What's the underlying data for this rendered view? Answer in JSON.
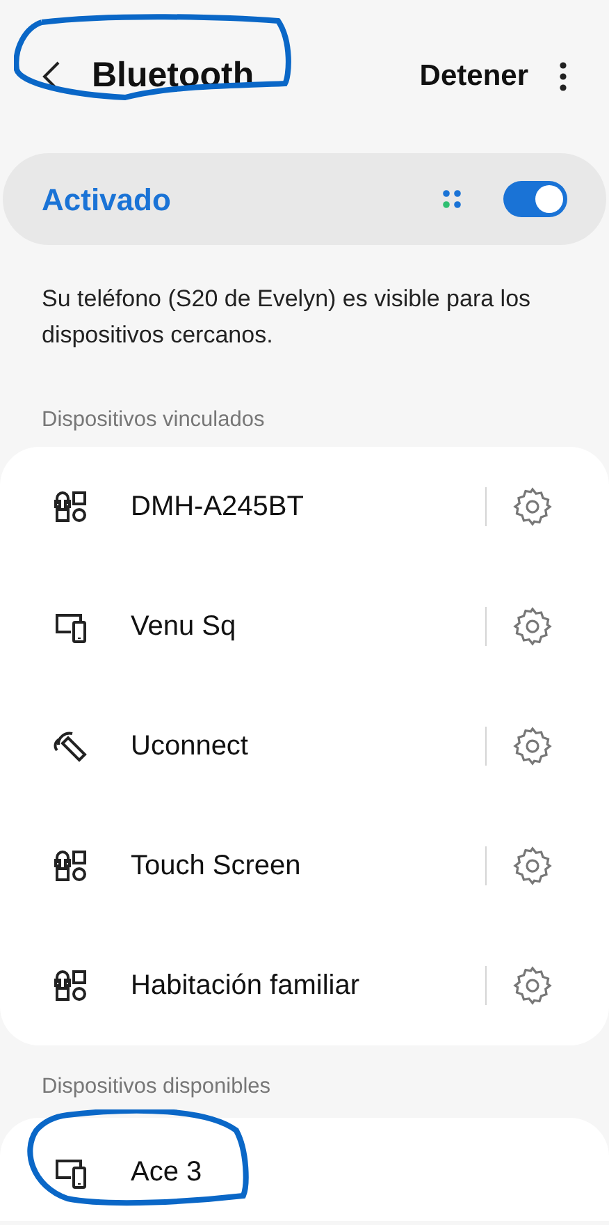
{
  "header": {
    "title": "Bluetooth",
    "circled": true,
    "action": "Detener"
  },
  "master": {
    "label": "Activado",
    "on": true
  },
  "description": "Su teléfono (S20 de Evelyn) es visible para los dispositivos cercanos.",
  "paired": {
    "heading": "Dispositivos vinculados",
    "devices": [
      {
        "name": "DMH-A245BT",
        "kind": "audio"
      },
      {
        "name": "Venu Sq",
        "kind": "devices"
      },
      {
        "name": "Uconnect",
        "kind": "earpiece"
      },
      {
        "name": "Touch Screen",
        "kind": "audio"
      },
      {
        "name": "Habitación familiar",
        "kind": "audio"
      }
    ]
  },
  "available": {
    "heading": "Dispositivos disponibles",
    "devices": [
      {
        "name": "Ace 3",
        "kind": "devices",
        "circled": true
      }
    ]
  }
}
